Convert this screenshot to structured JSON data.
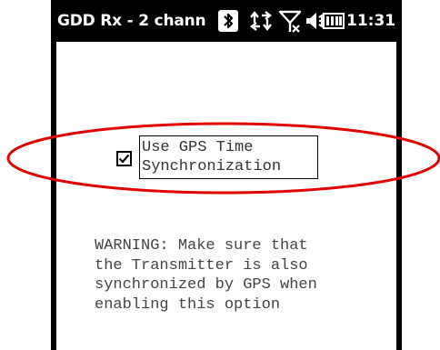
{
  "title_bar": {
    "app_title": "GDD Rx - 2 chann",
    "time": "11:31",
    "icons": [
      "bluetooth-icon",
      "data-connection-icon",
      "signal-no-service-icon",
      "volume-icon",
      "battery-icon"
    ]
  },
  "option": {
    "checked": true,
    "label_line1": "Use GPS Time",
    "label_line2": "Synchronization"
  },
  "warning": {
    "line1": "WARNING: Make sure that",
    "line2": "the Transmitter is also",
    "line3": "synchronized by GPS when",
    "line4": "enabling this option"
  },
  "colors": {
    "title_bar_bg": "#000000",
    "title_bar_text": "#ffffff",
    "content_bg": "#ffffff",
    "highlight_ellipse": "#e00000"
  }
}
